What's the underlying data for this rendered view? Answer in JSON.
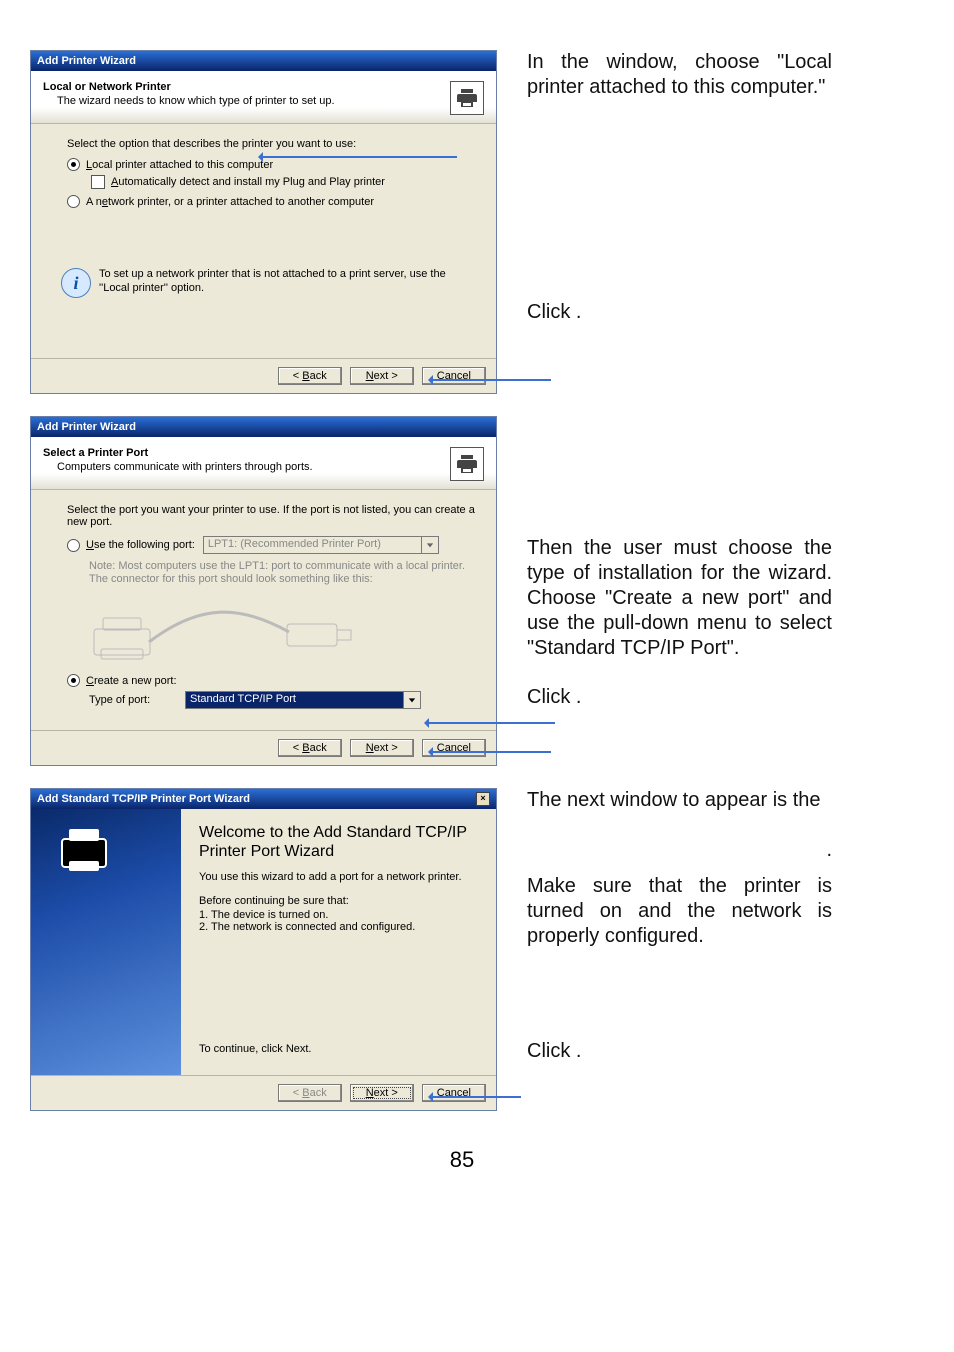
{
  "wiz1": {
    "title": "Add Printer Wizard",
    "header_title": "Local or Network Printer",
    "header_sub": "The wizard needs to know which type of printer to set up.",
    "lead": "Select the option that describes the printer you want to use:",
    "opt_local": "Local printer attached to this computer",
    "opt_auto": "Automatically detect and install my Plug and Play printer",
    "opt_network": "A network printer, or a printer attached to another computer",
    "info": "To set up a network printer that is not attached to a print server, use the ''Local printer'' option.",
    "btn_back": "< Back",
    "btn_next": "Next >",
    "btn_cancel": "Cancel"
  },
  "wiz2": {
    "title": "Add Printer Wizard",
    "header_title": "Select a Printer Port",
    "header_sub": "Computers communicate with printers through ports.",
    "lead": "Select the port you want your printer to use.  If the port is not listed, you can create a new port.",
    "opt_use": "Use the following port:",
    "port_value": "LPT1: (Recommended Printer Port)",
    "note1": "Note: Most computers use the LPT1: port to communicate with a local printer.",
    "note2": "The connector for this port should look something like this:",
    "opt_create": "Create a new port:",
    "type_label": "Type of port:",
    "type_value": "Standard TCP/IP Port",
    "btn_back": "< Back",
    "btn_next": "Next >",
    "btn_cancel": "Cancel"
  },
  "wiz3": {
    "title": "Add Standard TCP/IP Printer Port Wizard",
    "welcome": "Welcome to the Add Standard TCP/IP Printer Port Wizard",
    "use": "You use this wizard to add a port for a network printer.",
    "before": "Before continuing be sure that:",
    "before1": "1.  The device is turned on.",
    "before2": "2.  The network is connected and configured.",
    "cont": "To continue, click Next.",
    "btn_back": "< Back",
    "btn_next": "Next >",
    "btn_cancel": "Cancel"
  },
  "instr": {
    "p1": "In the window, choose \"Local printer attached to this computer.\"",
    "c1": "Click        .",
    "p2": "Then the user must choose the type of installation for the wizard. Choose \"Create a new port\" and use the pull-down menu to select \"Standard TCP/IP Port\".",
    "c2": "Click        .",
    "p3a": "The next window to appear is the",
    "p3b": ".",
    "p4": "Make sure that the printer is turned on and the network is properly configured.",
    "c3": "Click        ."
  },
  "page_number": "85"
}
